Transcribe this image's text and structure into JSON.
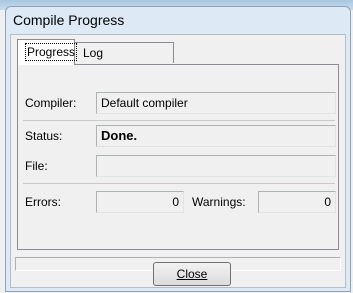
{
  "window": {
    "title": "Compile Progress"
  },
  "tabs": [
    {
      "label": "Progress",
      "active": true
    },
    {
      "label": "Log",
      "active": false
    }
  ],
  "fields": {
    "compiler_label": "Compiler:",
    "compiler_value": "Default compiler",
    "status_label": "Status:",
    "status_value": "Done.",
    "file_label": "File:",
    "file_value": "",
    "errors_label": "Errors:",
    "errors_value": "0",
    "warnings_label": "Warnings:",
    "warnings_value": "0"
  },
  "buttons": {
    "close_label": "Close"
  }
}
